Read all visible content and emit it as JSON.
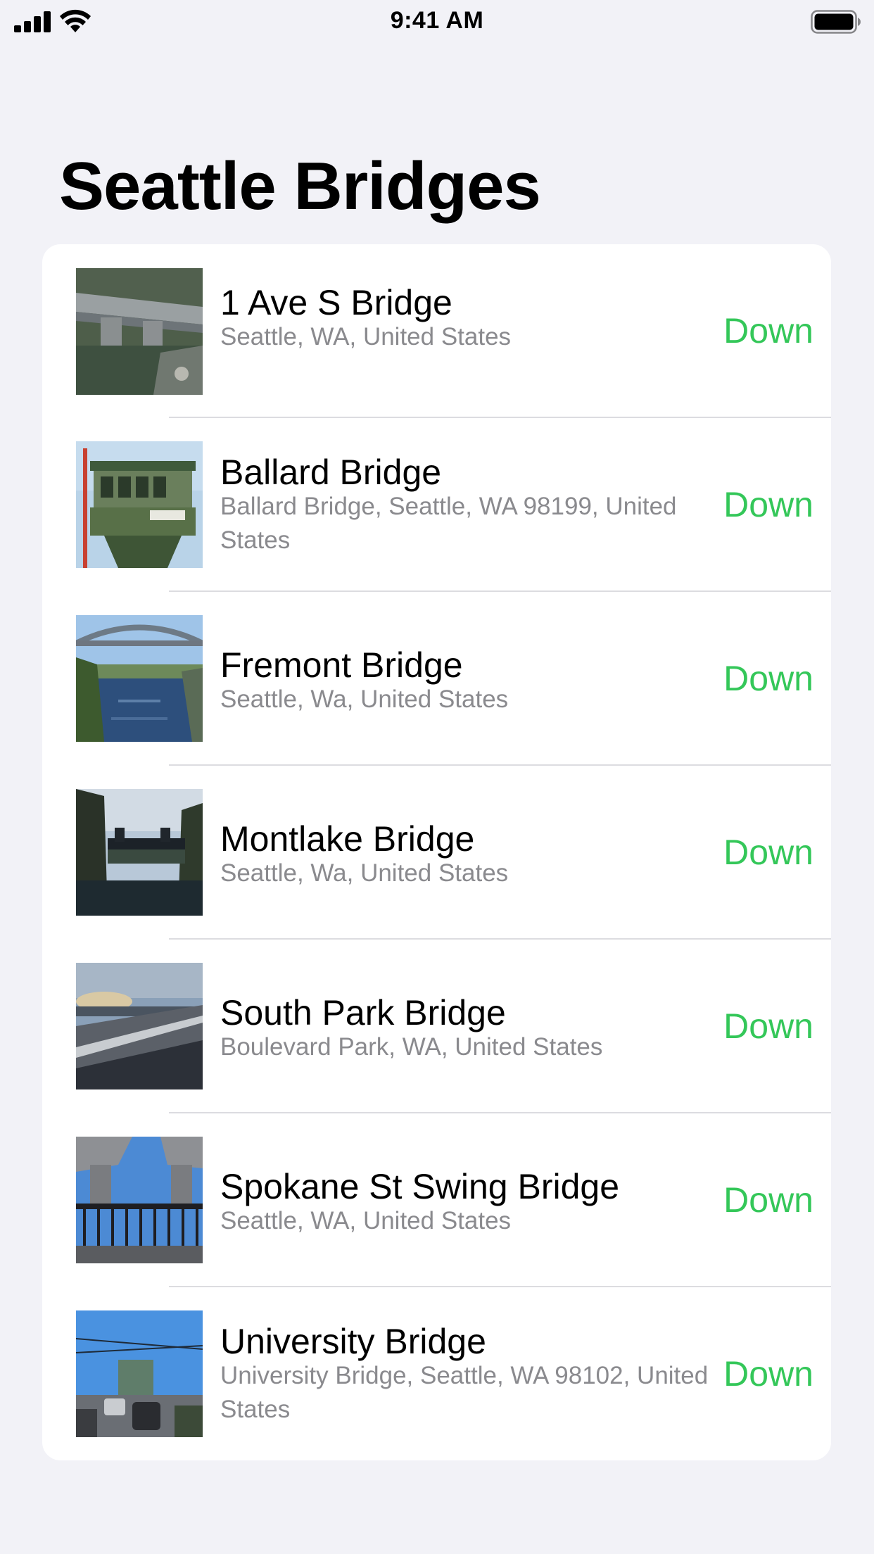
{
  "status_bar": {
    "time": "9:41 AM",
    "signal_icon": "cellular-signal-icon",
    "wifi_icon": "wifi-icon",
    "battery_icon": "battery-full-icon"
  },
  "header": {
    "title": "Seattle Bridges"
  },
  "colors": {
    "background": "#f2f2f7",
    "card": "#ffffff",
    "status_down": "#34c759",
    "secondary_text": "#8a8a8e"
  },
  "bridges": [
    {
      "name": "1 Ave S Bridge",
      "address": "Seattle, WA, United States",
      "status": "Down",
      "image": "aerial-bridge-photo"
    },
    {
      "name": "Ballard Bridge",
      "address": "Ballard Bridge, Seattle, WA 98199, United States",
      "status": "Down",
      "image": "bridge-tower-photo"
    },
    {
      "name": "Fremont Bridge",
      "address": "Seattle, Wa, United States",
      "status": "Down",
      "image": "arch-bridge-river-photo"
    },
    {
      "name": "Montlake Bridge",
      "address": "Seattle, Wa, United States",
      "status": "Down",
      "image": "bridge-silhouette-photo"
    },
    {
      "name": "South Park Bridge",
      "address": "Boulevard Park, WA, United States",
      "status": "Down",
      "image": "bridge-deck-sunset-photo"
    },
    {
      "name": "Spokane St Swing Bridge",
      "address": "Seattle, WA, United States",
      "status": "Down",
      "image": "underpass-railing-photo"
    },
    {
      "name": "University Bridge",
      "address": "University Bridge, Seattle, WA  98102, United States",
      "status": "Down",
      "image": "traffic-bridge-photo"
    }
  ]
}
